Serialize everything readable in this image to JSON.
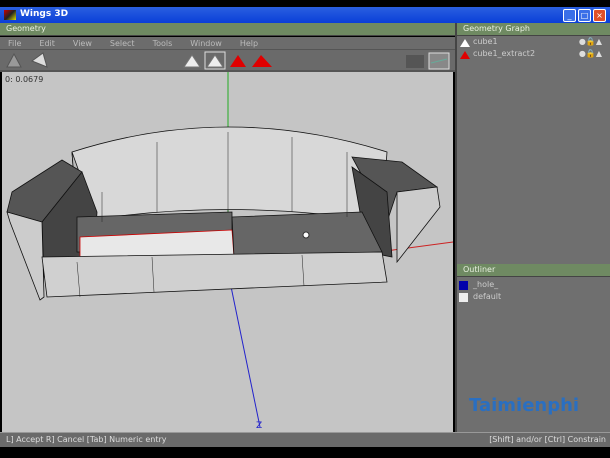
{
  "window": {
    "title": "Wings 3D",
    "min": "_",
    "max": "□",
    "close": "×"
  },
  "geometry": {
    "header": "Geometry",
    "menu": [
      "File",
      "Edit",
      "View",
      "Select",
      "Tools",
      "Window",
      "Help"
    ],
    "coords": "0: 0.0679"
  },
  "geometry_graph": {
    "header": "Geometry Graph",
    "items": [
      {
        "name": "cube1"
      },
      {
        "name": "cube1_extract2"
      }
    ]
  },
  "outliner": {
    "header": "Outliner",
    "items": [
      "_hole_",
      "default"
    ]
  },
  "status": {
    "left": "L] Accept  R] Cancel  [Tab] Numeric entry",
    "right": "[Shift] and/or [Ctrl] Constrain"
  },
  "watermark": "Taimienphi",
  "axis": {
    "z": "Z"
  },
  "colors": {
    "title": "#0a3fd8",
    "header": "#6f8a62",
    "selected": "#e00000"
  }
}
